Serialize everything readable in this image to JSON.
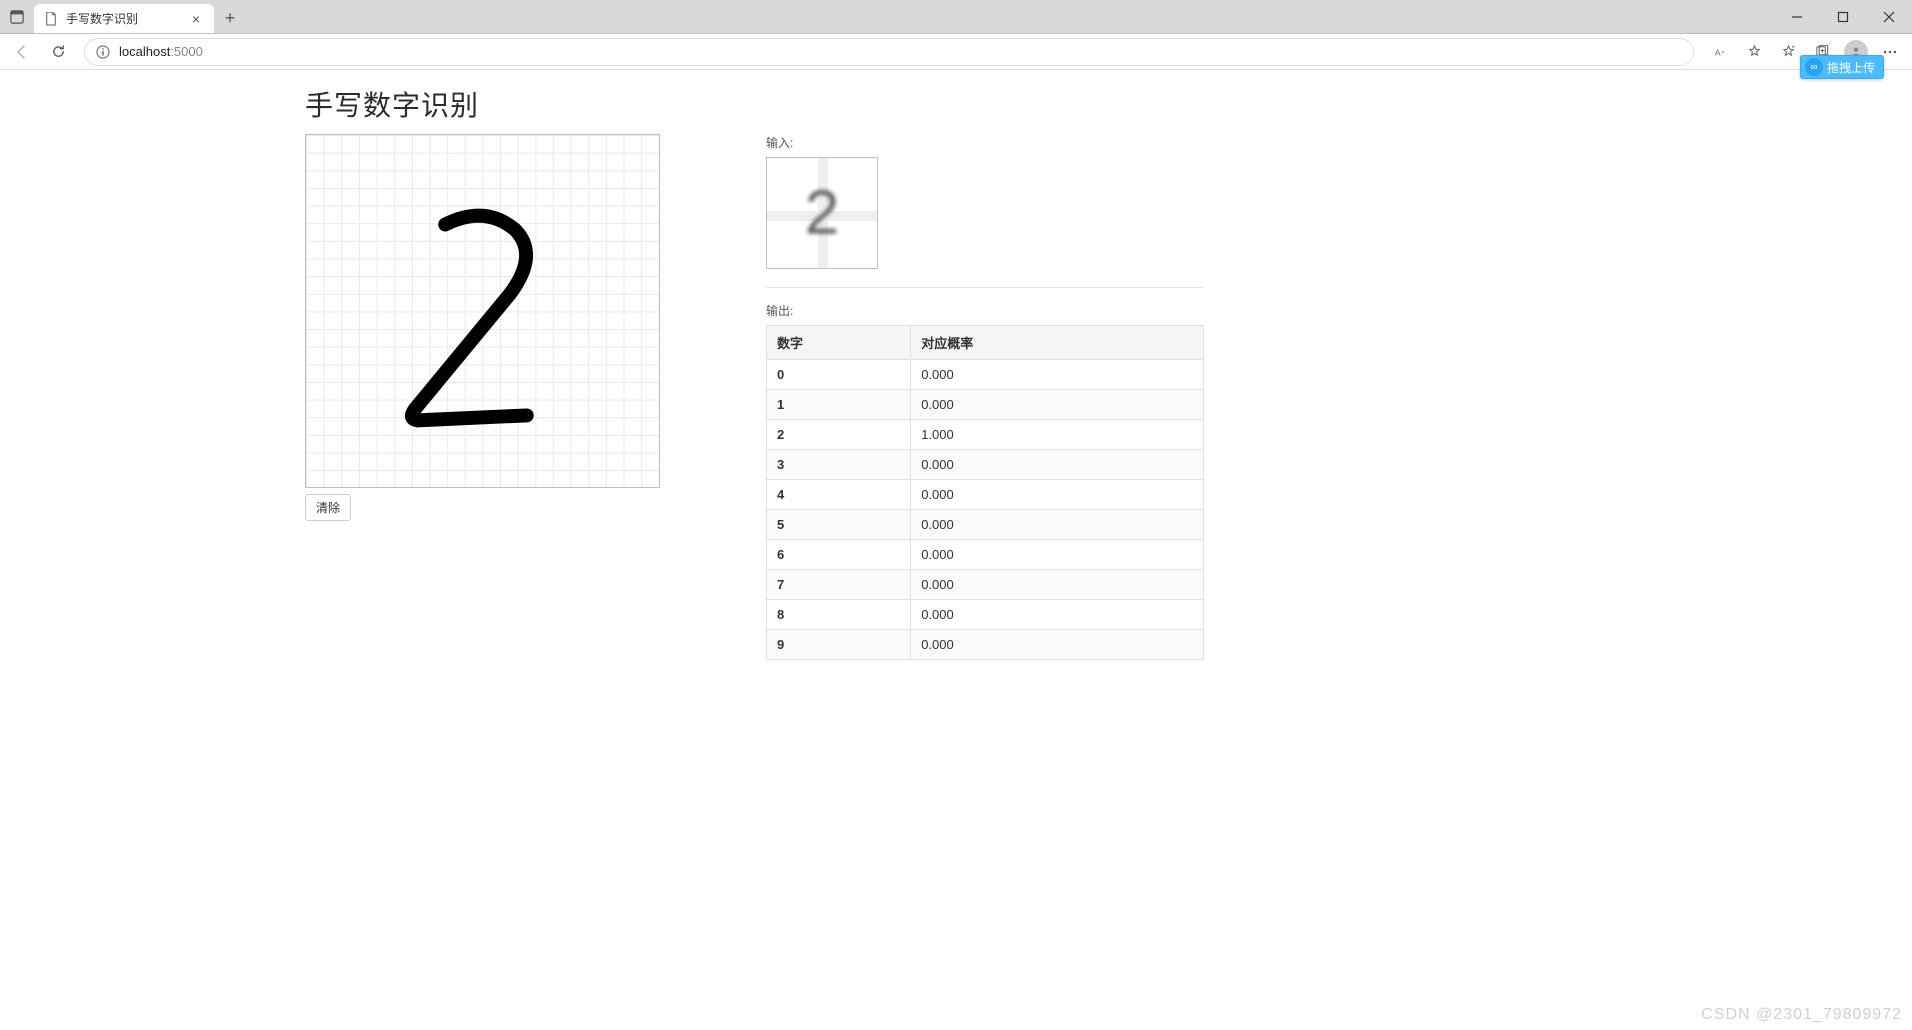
{
  "browser": {
    "tab_title": "手写数字识别",
    "url_host": "localhost",
    "url_rest": ":5000"
  },
  "upload_badge": "拖拽上传",
  "page": {
    "heading": "手写数字识别",
    "clear_button": "清除",
    "input_label": "输入:",
    "output_label": "输出:",
    "drawn_digit": "2",
    "preview_digit": "2",
    "table": {
      "col_digit": "数字",
      "col_prob": "对应概率",
      "rows": [
        {
          "digit": "0",
          "prob": "0.000"
        },
        {
          "digit": "1",
          "prob": "0.000"
        },
        {
          "digit": "2",
          "prob": "1.000"
        },
        {
          "digit": "3",
          "prob": "0.000"
        },
        {
          "digit": "4",
          "prob": "0.000"
        },
        {
          "digit": "5",
          "prob": "0.000"
        },
        {
          "digit": "6",
          "prob": "0.000"
        },
        {
          "digit": "7",
          "prob": "0.000"
        },
        {
          "digit": "8",
          "prob": "0.000"
        },
        {
          "digit": "9",
          "prob": "0.000"
        }
      ]
    }
  },
  "watermark": "CSDN @2301_79809972"
}
